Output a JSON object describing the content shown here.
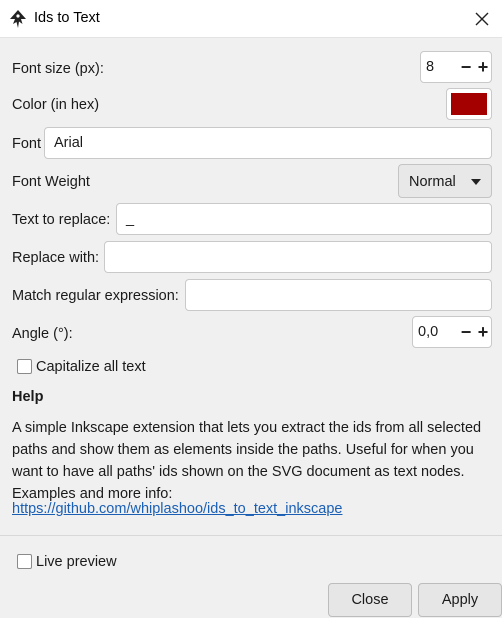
{
  "window": {
    "title": "Ids to Text",
    "app_icon": "inkscape-logo-icon",
    "close_icon": "close-icon"
  },
  "form": {
    "font_size": {
      "label": "Font size (px):",
      "value": "8"
    },
    "color": {
      "label": "Color (in hex)",
      "value": "#a50000"
    },
    "font": {
      "label": "Font",
      "value": "Arial"
    },
    "font_weight": {
      "label": "Font Weight",
      "value": "Normal"
    },
    "text_to_replace": {
      "label": "Text to replace:",
      "value": "_"
    },
    "replace_with": {
      "label": "Replace with:",
      "value": ""
    },
    "regex": {
      "label": "Match regular expression:",
      "value": ""
    },
    "angle": {
      "label": "Angle (°):",
      "value": "0,0"
    },
    "capitalize": {
      "label": "Capitalize all text",
      "checked": false
    }
  },
  "help": {
    "heading": "Help",
    "text": "A simple Inkscape extension that lets you extract the ids from all selected paths and show them as elements inside the paths. Useful for when you want to have all paths' ids shown on the SVG document as text nodes. Examples and more info:",
    "link": "https://github.com/whiplashoo/ids_to_text_inkscape"
  },
  "footer": {
    "live_preview": {
      "label": "Live preview",
      "checked": false
    },
    "close_label": "Close",
    "apply_label": "Apply"
  },
  "spin_symbols": {
    "minus": "−",
    "plus": "+"
  }
}
